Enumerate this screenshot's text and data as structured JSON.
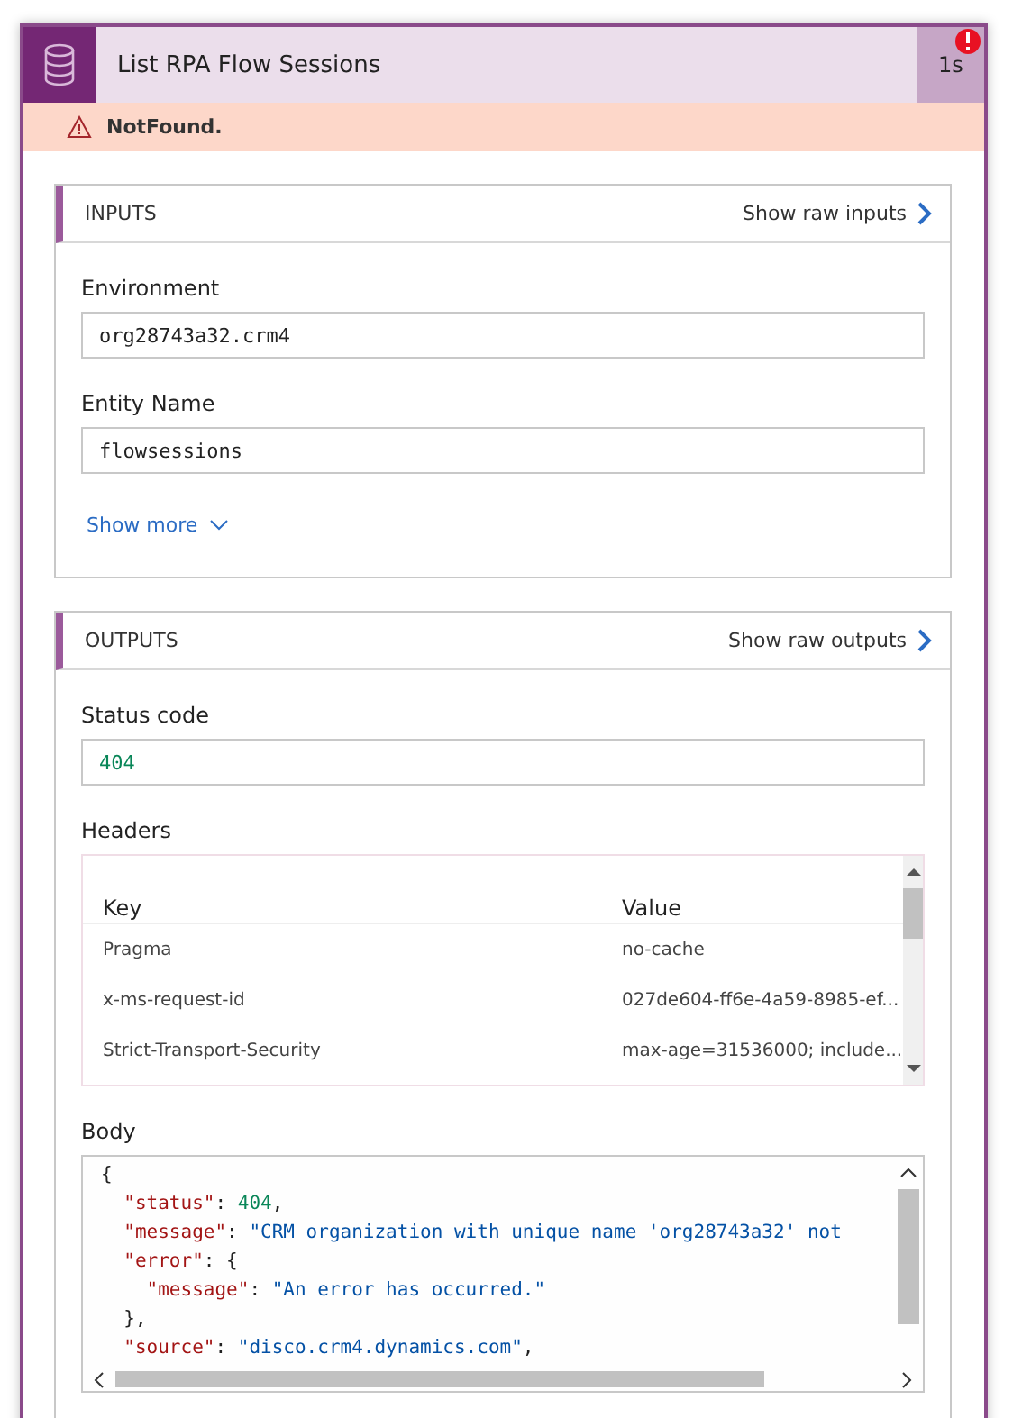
{
  "action": {
    "title": "List RPA Flow Sessions",
    "duration": "1s",
    "has_error": true
  },
  "error_bar": {
    "message": "NotFound."
  },
  "inputs": {
    "title": "INPUTS",
    "raw_link": "Show raw inputs",
    "fields": [
      {
        "label": "Environment",
        "value": "org28743a32.crm4"
      },
      {
        "label": "Entity Name",
        "value": "flowsessions"
      }
    ],
    "show_more": "Show more"
  },
  "outputs": {
    "title": "OUTPUTS",
    "raw_link": "Show raw outputs",
    "status": {
      "label": "Status code",
      "value": "404"
    },
    "headers": {
      "label": "Headers",
      "columns": [
        "Key",
        "Value"
      ],
      "rows": [
        [
          "Pragma",
          "no-cache"
        ],
        [
          "x-ms-request-id",
          "027de604-ff6e-4a59-8985-ef..."
        ],
        [
          "Strict-Transport-Security",
          "max-age=31536000; include..."
        ]
      ]
    },
    "body": {
      "label": "Body",
      "lines": [
        [
          {
            "kind": "punct",
            "text": "{"
          }
        ],
        [
          {
            "kind": "key",
            "text": "  \"status\""
          },
          {
            "kind": "punct",
            "text": ": "
          },
          {
            "kind": "number",
            "text": "404"
          },
          {
            "kind": "punct",
            "text": ","
          }
        ],
        [
          {
            "kind": "key",
            "text": "  \"message\""
          },
          {
            "kind": "punct",
            "text": ": "
          },
          {
            "kind": "string",
            "text": "\"CRM organization with unique name 'org28743a32' not"
          }
        ],
        [
          {
            "kind": "key",
            "text": "  \"error\""
          },
          {
            "kind": "punct",
            "text": ": {"
          }
        ],
        [
          {
            "kind": "key",
            "text": "    \"message\""
          },
          {
            "kind": "punct",
            "text": ": "
          },
          {
            "kind": "string",
            "text": "\"An error has occurred.\""
          }
        ],
        [
          {
            "kind": "punct",
            "text": "  },"
          }
        ],
        [
          {
            "kind": "key",
            "text": "  \"source\""
          },
          {
            "kind": "punct",
            "text": ": "
          },
          {
            "kind": "string",
            "text": "\"disco.crm4.dynamics.com\""
          },
          {
            "kind": "punct",
            "text": ","
          }
        ]
      ]
    }
  }
}
